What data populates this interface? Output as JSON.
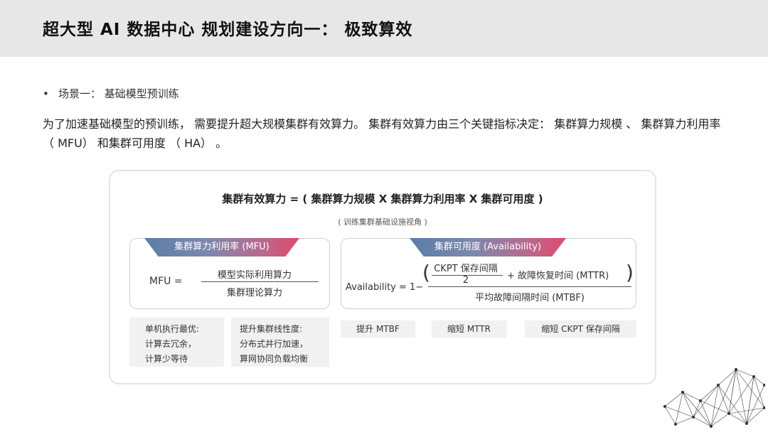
{
  "header": {
    "title": "超大型 AI 数据中心 规划建设方向一： 极致算效"
  },
  "bullet": {
    "dot": "•",
    "text": "场景一： 基础模型预训练"
  },
  "intro": {
    "text": "为了加速基础模型的预训练， 需要提升超大规模集群有效算力。 集群有效算力由三个关键指标决定： 集群算力规模 、 集群算力利用率 （ MFU） 和集群可用度 （ HA） 。"
  },
  "diagram": {
    "formula": "集群有效算力 = ( 集群算力规模 X 集群算力利用率 X 集群可用度 )",
    "formula_note": "( 训练集群基础设施视角 )",
    "mfu": {
      "banner": "集群算力利用率 (MFU)",
      "label": "MFU =",
      "numerator": "模型实际利用算力",
      "denominator": "集群理论算力",
      "chips": [
        [
          "单机执行最优:",
          "计算去冗余，",
          "计算少等待"
        ],
        [
          "提升集群线性度:",
          "分布式并行加速，",
          "算网协同负载均衡"
        ]
      ]
    },
    "availability": {
      "banner": "集群可用度 (Availability)",
      "label": "Availability = 1−",
      "paren_left": "(",
      "paren_right": ")",
      "inner_top": "CKPT 保存间隔",
      "inner_bottom": "2",
      "plus_term": "+ 故障恢复时间 (MTTR)",
      "denominator": "平均故障间隔时间 (MTBF)",
      "chips": [
        "提升 MTBF",
        "缩短 MTTR",
        "缩短 CKPT 保存间隔"
      ]
    }
  },
  "colors": {
    "title_bar": "#e7e7e7",
    "banner_start": "#5b7ea7",
    "banner_end": "#e4486b",
    "chip_bg": "#f1f1f1"
  },
  "decoration": {
    "icon": "network-mesh-icon"
  }
}
